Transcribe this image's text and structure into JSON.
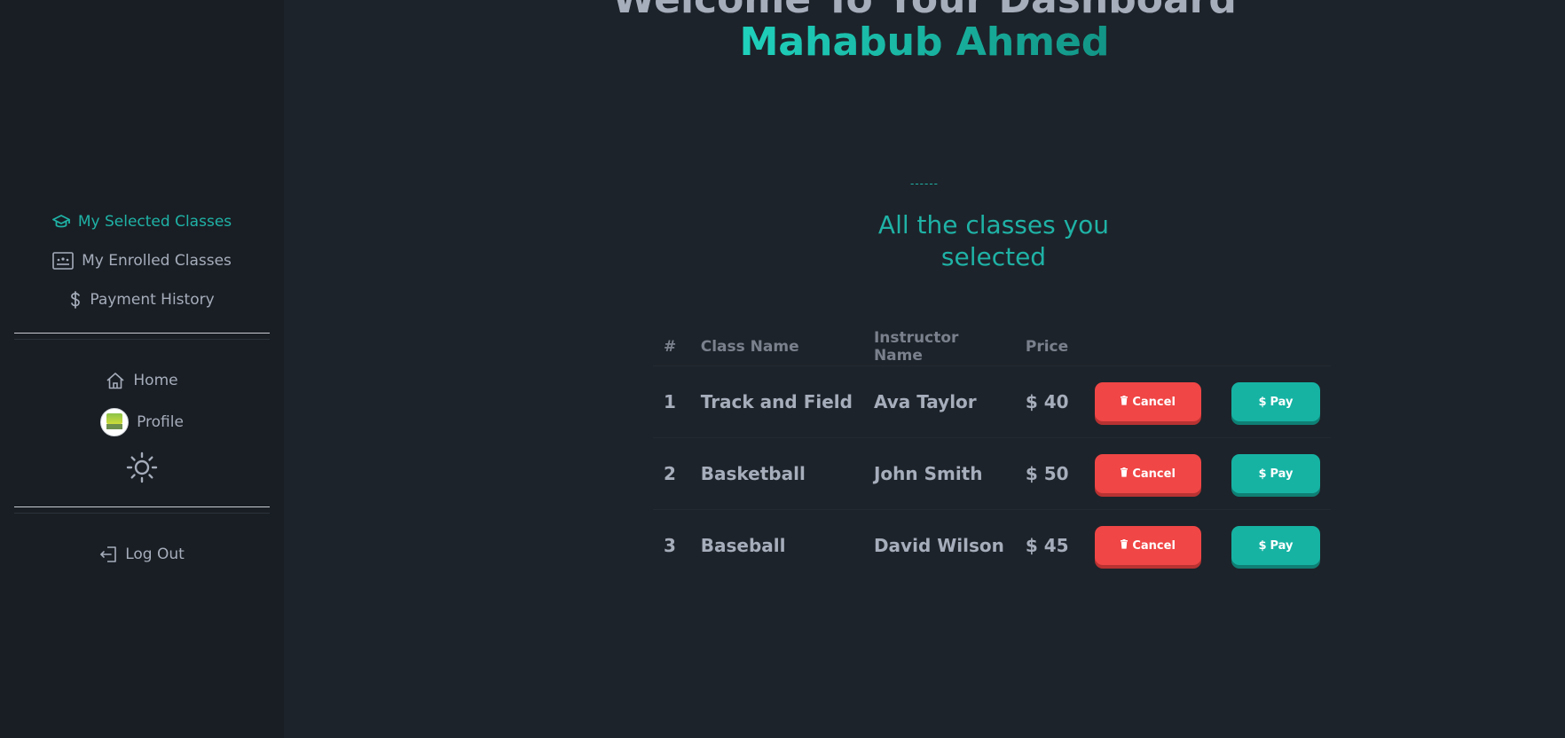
{
  "sidebar": {
    "items": [
      {
        "label": "My Selected Classes",
        "icon": "graduation-cap-icon",
        "active": true
      },
      {
        "label": "My Enrolled Classes",
        "icon": "chalkboard-icon",
        "active": false
      },
      {
        "label": "Payment History",
        "icon": "dollar-icon",
        "active": false
      }
    ],
    "links": [
      {
        "label": "Home",
        "icon": "home-icon"
      },
      {
        "label": "Profile",
        "icon": "avatar"
      }
    ],
    "theme_toggle_icon": "sun-icon",
    "logout_label": "Log Out"
  },
  "header": {
    "welcome": "Welcome To Your Dashboard",
    "user_name": "Mahabub Ahmed"
  },
  "section": {
    "dashes": "------",
    "title": "All the classes you selected"
  },
  "table": {
    "columns": [
      "#",
      "Class Name",
      "Instructor Name",
      "Price"
    ],
    "rows": [
      {
        "index": "1",
        "class_name": "Track and Field",
        "instructor": "Ava Taylor",
        "price": "$ 40"
      },
      {
        "index": "2",
        "class_name": "Basketball",
        "instructor": "John Smith",
        "price": "$ 50"
      },
      {
        "index": "3",
        "class_name": "Baseball",
        "instructor": "David Wilson",
        "price": "$ 45"
      }
    ],
    "cancel_label": "Cancel",
    "pay_label": "Pay",
    "pay_symbol": "$"
  },
  "colors": {
    "accent": "#1fb2a6",
    "cancel": "#f04646",
    "pay": "#16b3a3",
    "background": "#1d232a",
    "sidebar": "#191e24"
  }
}
